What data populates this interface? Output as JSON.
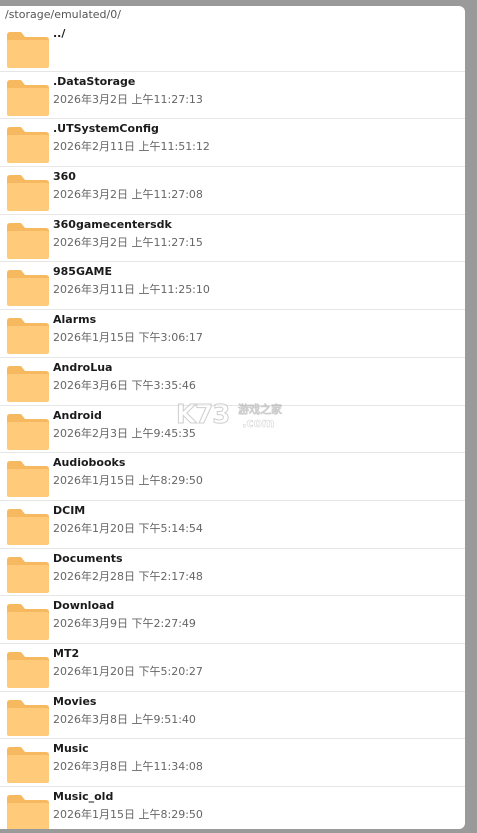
{
  "path": "/storage/emulated/0/",
  "colors": {
    "folder_front": "#FFCB7A",
    "folder_back": "#F7B960",
    "divider": "#E6E6E6",
    "backdrop": "#9A9A9A"
  },
  "folder_icon": "folder-icon",
  "entries": [
    {
      "name": "../",
      "date": ""
    },
    {
      "name": ".DataStorage",
      "date": "2026年3月2日 上午11:27:13"
    },
    {
      "name": ".UTSystemConfig",
      "date": "2026年2月11日 上午11:51:12"
    },
    {
      "name": "360",
      "date": "2026年3月2日 上午11:27:08"
    },
    {
      "name": "360gamecentersdk",
      "date": "2026年3月2日 上午11:27:15"
    },
    {
      "name": "985GAME",
      "date": "2026年3月11日 上午11:25:10"
    },
    {
      "name": "Alarms",
      "date": "2026年1月15日 下午3:06:17"
    },
    {
      "name": "AndroLua",
      "date": "2026年3月6日 下午3:35:46"
    },
    {
      "name": "Android",
      "date": "2026年2月3日 上午9:45:35"
    },
    {
      "name": "Audiobooks",
      "date": "2026年1月15日 上午8:29:50"
    },
    {
      "name": "DCIM",
      "date": "2026年1月20日 下午5:14:54"
    },
    {
      "name": "Documents",
      "date": "2026年2月28日 下午2:17:48"
    },
    {
      "name": "Download",
      "date": "2026年3月9日 下午2:27:49"
    },
    {
      "name": "MT2",
      "date": "2026年1月20日 下午5:20:27"
    },
    {
      "name": "Movies",
      "date": "2026年3月8日 上午9:51:40"
    },
    {
      "name": "Music",
      "date": "2026年3月8日 上午11:34:08"
    },
    {
      "name": "Music_old",
      "date": "2026年1月15日 上午8:29:50"
    }
  ],
  "watermark": {
    "main": "K73",
    "sub": "游戏之家",
    "domain": ".com"
  }
}
